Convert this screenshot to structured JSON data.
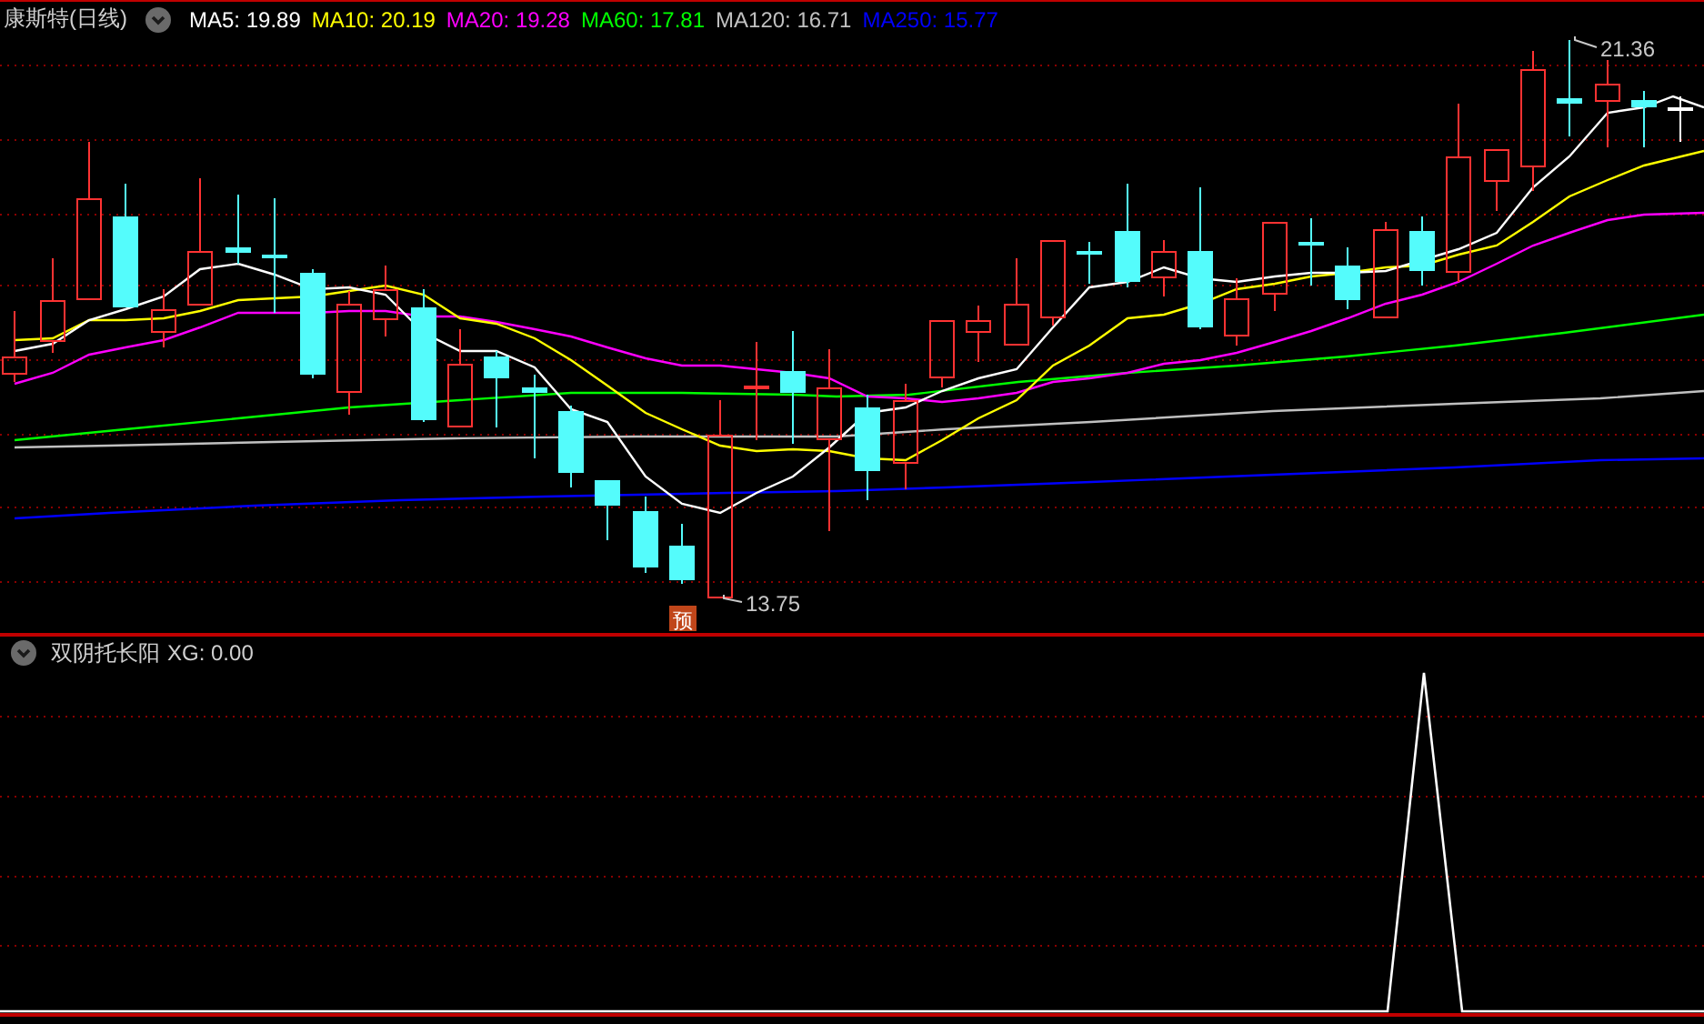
{
  "title": "康斯特(日线)",
  "indicators": [
    {
      "label": "MA5: 19.89",
      "color": "#ffffff"
    },
    {
      "label": "MA10: 20.19",
      "color": "#ffff00"
    },
    {
      "label": "MA20: 19.28",
      "color": "#ff00ff"
    },
    {
      "label": "MA60: 17.81",
      "color": "#00ff00"
    },
    {
      "label": "MA120: 16.71",
      "color": "#c0c0c0"
    },
    {
      "label": "MA250: 15.77",
      "color": "#0000ff"
    }
  ],
  "price_labels": [
    {
      "kind": "high",
      "text": "21.36"
    },
    {
      "kind": "low",
      "text": "13.75"
    }
  ],
  "forecast_badge": "预",
  "sub_panel": {
    "name": "双阴托长阳",
    "value": "XG: 0.00"
  }
}
